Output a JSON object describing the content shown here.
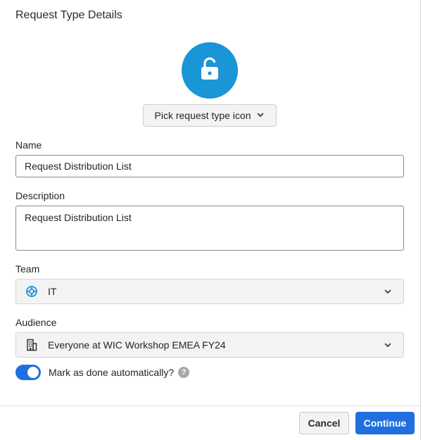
{
  "dialog": {
    "title": "Request Type Details"
  },
  "icon_picker": {
    "selected_icon": "unlocked-lock-icon",
    "circle_color": "#1a95d6",
    "button_label": "Pick request type icon"
  },
  "form": {
    "name": {
      "label": "Name",
      "value": "Request Distribution List"
    },
    "description": {
      "label": "Description",
      "value": "Request Distribution List"
    },
    "team": {
      "label": "Team",
      "icon": "support-lifebuoy-icon",
      "value": "IT"
    },
    "audience": {
      "label": "Audience",
      "icon": "building-icon",
      "value": "Everyone at WIC Workshop EMEA FY24"
    },
    "auto_done": {
      "label": "Mark as done automatically?",
      "enabled": true,
      "help_glyph": "?"
    }
  },
  "footer": {
    "cancel_label": "Cancel",
    "continue_label": "Continue"
  },
  "colors": {
    "accent": "#1f6fe0",
    "icon_circle": "#1a95d6"
  }
}
